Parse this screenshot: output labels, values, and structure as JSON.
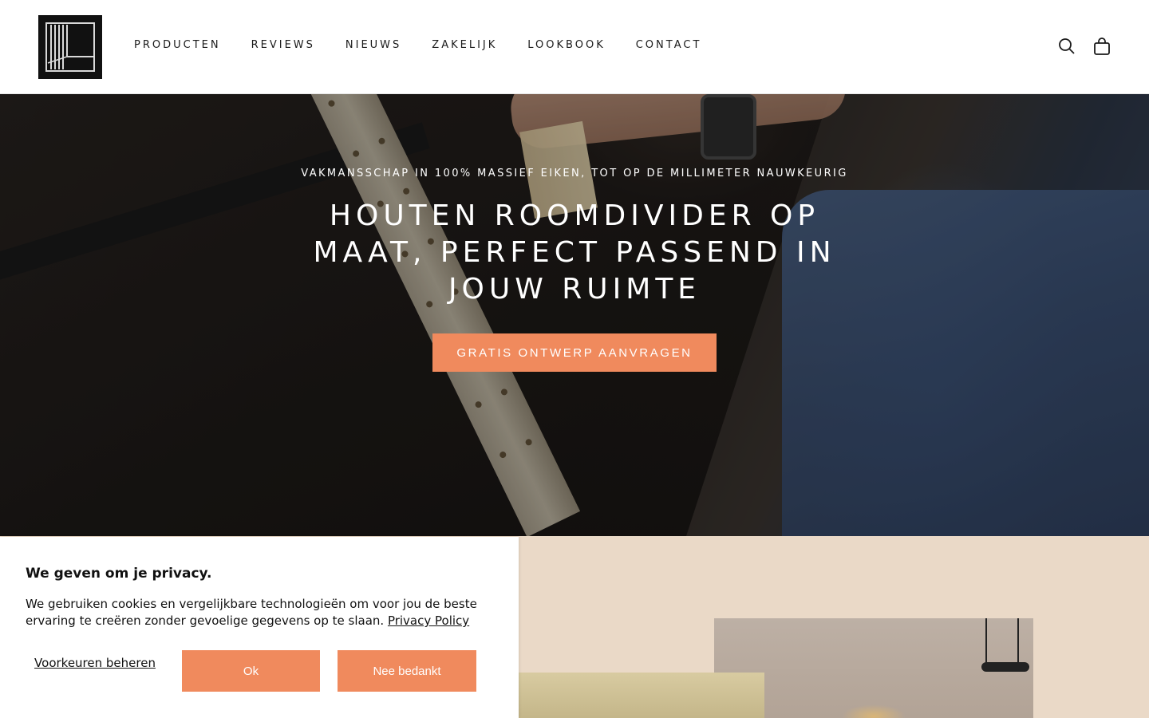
{
  "header": {
    "logo_icon": "brand-logo-icon",
    "nav": [
      {
        "label": "PRODUCTEN"
      },
      {
        "label": "REVIEWS"
      },
      {
        "label": "NIEUWS"
      },
      {
        "label": "ZAKELIJK"
      },
      {
        "label": "LOOKBOOK"
      },
      {
        "label": "CONTACT"
      }
    ],
    "icons": [
      "search-icon",
      "shopping-bag-icon"
    ]
  },
  "hero": {
    "kicker": "VAKMANSSCHAP IN 100% MASSIEF EIKEN, TOT OP DE MILLIMETER NAUWKEURIG",
    "title": "HOUTEN ROOMDIVIDER OP MAAT, PERFECT PASSEND IN JOUW RUIMTE",
    "cta_label": "GRATIS ONTWERP AANVRAGEN"
  },
  "cookie_banner": {
    "title": "We geven om je privacy.",
    "text": "We gebruiken cookies en vergelijkbare technologieën om voor jou de beste ervaring te creëren zonder gevoelige gegevens op te slaan. ",
    "link_label": "Privacy Policy",
    "preferences_label": "Voorkeuren beheren",
    "ok_label": "Ok",
    "decline_label": "Nee bedankt"
  },
  "colors": {
    "accent": "#f08a5d",
    "section_bg": "#ead9c7",
    "text": "#1a1a1a"
  }
}
